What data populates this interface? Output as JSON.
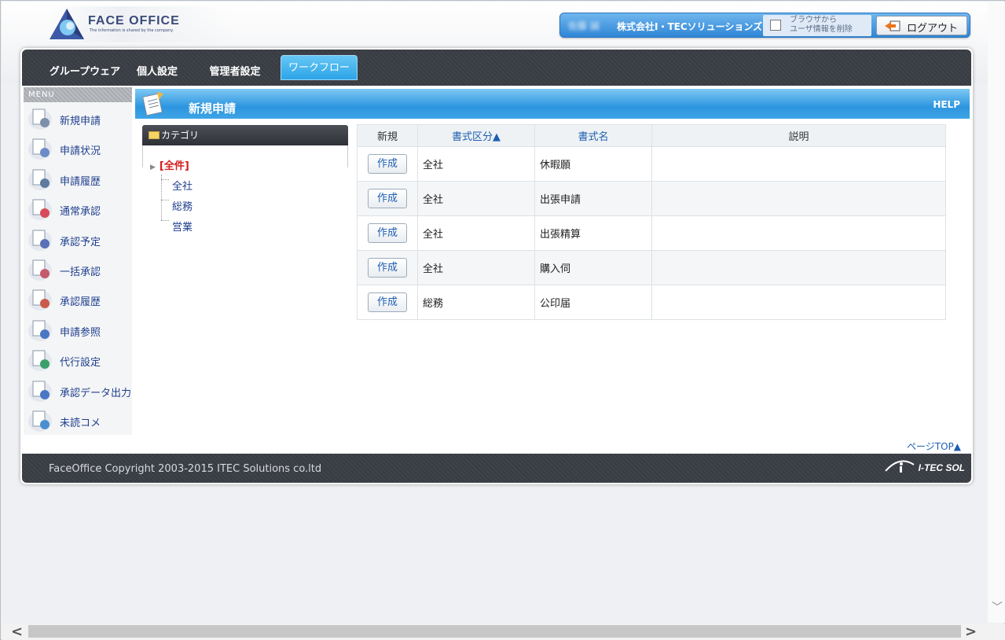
{
  "header": {
    "logo_title": "FACE OFFICE",
    "logo_tagline": "The information is shared by the company.",
    "user_name": "佐藤 誠",
    "company": "株式会社I・TECソリューションズ",
    "clear_user_info_label": "ブラウザから\nユーザ情報を削除",
    "logout_label": "ログアウト"
  },
  "tabs": [
    {
      "label": "グループウェア"
    },
    {
      "label": "個人設定"
    },
    {
      "label": "管理者設定"
    },
    {
      "label": "ワークフロー",
      "active": true
    }
  ],
  "sidebar": {
    "header": "MENU",
    "items": [
      {
        "label": "新規申請",
        "icon": "new-request-icon"
      },
      {
        "label": "申請状況",
        "icon": "request-status-icon"
      },
      {
        "label": "申請履歴",
        "icon": "request-history-icon"
      },
      {
        "label": "通常承認",
        "icon": "approval-icon"
      },
      {
        "label": "承認予定",
        "icon": "approval-schedule-icon"
      },
      {
        "label": "一括承認",
        "icon": "bulk-approval-icon"
      },
      {
        "label": "承認履歴",
        "icon": "approval-history-icon"
      },
      {
        "label": "申請参照",
        "icon": "request-reference-icon"
      },
      {
        "label": "代行設定",
        "icon": "proxy-setting-icon"
      },
      {
        "label": "承認データ出力",
        "icon": "approval-export-icon"
      },
      {
        "label": "未読コメ",
        "icon": "unread-comment-icon"
      }
    ]
  },
  "content": {
    "title": "新規申請",
    "help": "HELP",
    "page_top": "ページTOP▲"
  },
  "category": {
    "header": "カテゴリ",
    "all_label": "[全件]",
    "children": [
      "全社",
      "総務",
      "営業"
    ]
  },
  "table": {
    "headers": {
      "new": "新規",
      "type": "書式区分▲",
      "name": "書式名",
      "description": "説明"
    },
    "rows": [
      {
        "button": "作成",
        "type": "全社",
        "name": "休暇願",
        "description": ""
      },
      {
        "button": "作成",
        "type": "全社",
        "name": "出張申請",
        "description": ""
      },
      {
        "button": "作成",
        "type": "全社",
        "name": "出張精算",
        "description": ""
      },
      {
        "button": "作成",
        "type": "全社",
        "name": "購入伺",
        "description": ""
      },
      {
        "button": "作成",
        "type": "総務",
        "name": "公印届",
        "description": ""
      }
    ]
  },
  "footer": {
    "copyright": "FaceOffice Copyright 2003-2015 ITEC Solutions co.ltd",
    "brand": "I-TEC SOL"
  },
  "colors": {
    "accent_blue": "#2d95df",
    "link_blue": "#1f3f8f",
    "active_red": "#d41d1d",
    "dark_bar": "#3f434a"
  }
}
